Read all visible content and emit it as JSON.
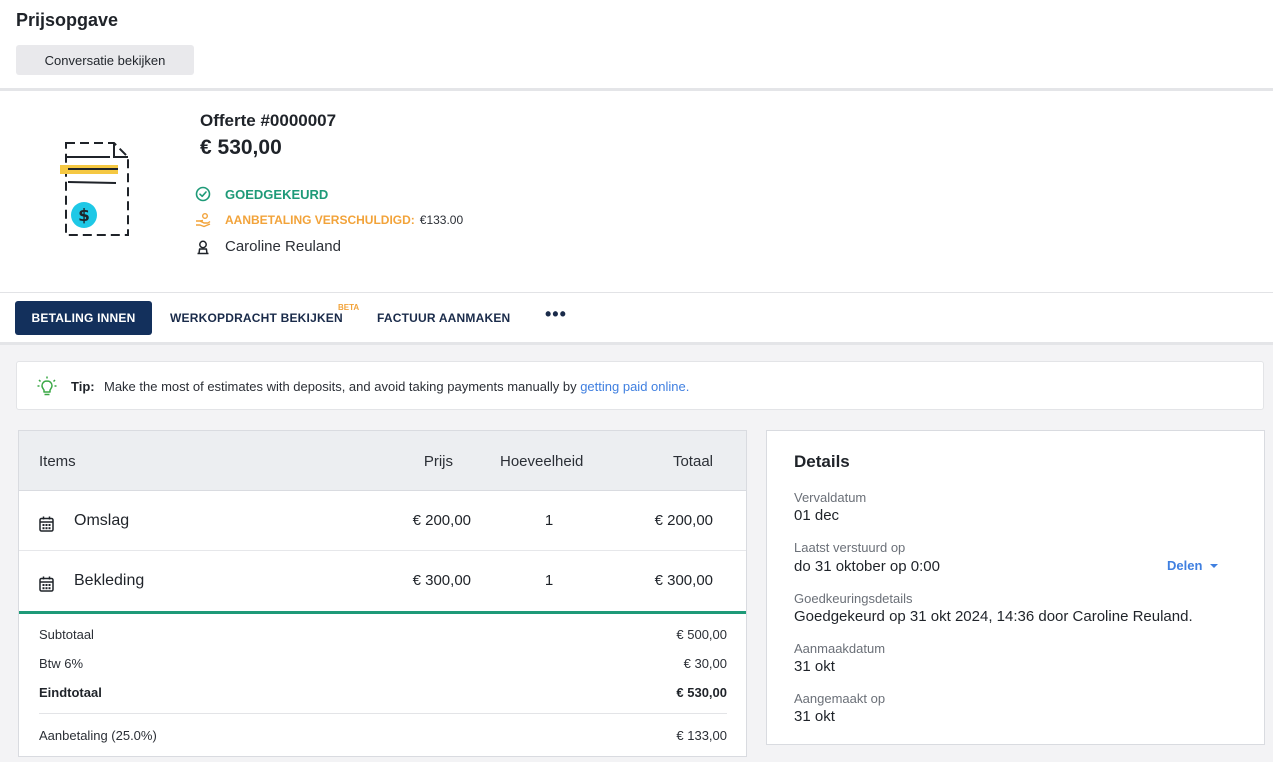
{
  "header": {
    "title": "Prijsopgave",
    "view_conversation": "Conversatie bekijken"
  },
  "quote": {
    "number": "Offerte #0000007",
    "amount": "€ 530,00",
    "status_approved": "GOEDGEKEURD",
    "deposit_label": "AANBETALING VERSCHULDIGD:",
    "deposit_amount": "€133.00",
    "client": "Caroline Reuland"
  },
  "actions": {
    "collect_payment": "BETALING INNEN",
    "view_work_order": "WERKOPDRACHT BEKIJKEN",
    "beta_badge": "BETA",
    "create_invoice": "FACTUUR AANMAKEN",
    "more": "•••"
  },
  "tip": {
    "label": "Tip:",
    "text": "Make the most of estimates with deposits, and avoid taking payments manually by",
    "link": "getting paid online."
  },
  "items": {
    "headers": {
      "items": "Items",
      "price": "Prijs",
      "quantity": "Hoeveelheid",
      "total": "Totaal"
    },
    "rows": [
      {
        "name": "Omslag",
        "price": "€ 200,00",
        "quantity": "1",
        "total": "€ 200,00"
      },
      {
        "name": "Bekleding",
        "price": "€ 300,00",
        "quantity": "1",
        "total": "€ 300,00"
      }
    ],
    "summary": {
      "subtotal_label": "Subtotaal",
      "subtotal": "€ 500,00",
      "tax_label": "Btw 6%",
      "tax": "€ 30,00",
      "grand_total_label": "Eindtotaal",
      "grand_total": "€ 530,00",
      "deposit_label": "Aanbetaling (25.0%)",
      "deposit": "€ 133,00"
    }
  },
  "details": {
    "title": "Details",
    "due_date_label": "Vervaldatum",
    "due_date": "01 dec",
    "last_sent_label": "Laatst verstuurd op",
    "last_sent": "do 31 oktober op 0:00",
    "share": "Delen",
    "approval_label": "Goedkeuringsdetails",
    "approval": "Goedgekeurd op 31 okt 2024, 14:36 door Caroline Reuland.",
    "created_date_label": "Aanmaakdatum",
    "created_date": "31 okt",
    "created_on_label": "Aangemaakt op",
    "created_on": "31 okt"
  },
  "colors": {
    "primary": "#13305c",
    "success": "#1e9a78",
    "warning": "#f2a33a",
    "link": "#3f7fe0",
    "icon_yellow": "#f5c842",
    "icon_cyan": "#1ec8e6"
  }
}
